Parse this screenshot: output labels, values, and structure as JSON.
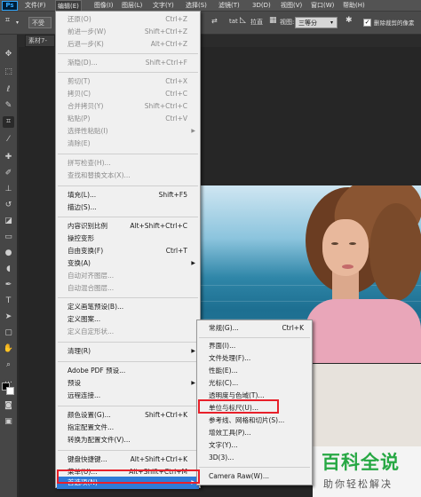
{
  "app": {
    "logo": "Ps"
  },
  "menubar": {
    "items": [
      "文件(F)",
      "编辑(E)",
      "图像(I)",
      "图层(L)",
      "文字(Y)",
      "选择(S)",
      "滤镜(T)",
      "3D(D)",
      "视图(V)",
      "窗口(W)",
      "帮助(H)"
    ]
  },
  "optionbar": {
    "ratio_label": "不受",
    "straighten": "拉直",
    "view_label": "视图:",
    "view_value": "三等分",
    "delete_cropped_label": "删除裁剪的像素"
  },
  "document": {
    "tab_title": "素材7-"
  },
  "edit_menu": {
    "items": [
      {
        "label": "还原(O)",
        "shortcut": "Ctrl+Z",
        "disabled": true
      },
      {
        "label": "前进一步(W)",
        "shortcut": "Shift+Ctrl+Z",
        "disabled": true
      },
      {
        "label": "后退一步(K)",
        "shortcut": "Alt+Ctrl+Z",
        "disabled": true
      },
      {
        "label": "渐隐(D)...",
        "shortcut": "Shift+Ctrl+F",
        "disabled": true
      },
      {
        "label": "剪切(T)",
        "shortcut": "Ctrl+X",
        "disabled": true
      },
      {
        "label": "拷贝(C)",
        "shortcut": "Ctrl+C",
        "disabled": true
      },
      {
        "label": "合并拷贝(Y)",
        "shortcut": "Shift+Ctrl+C",
        "disabled": true
      },
      {
        "label": "粘贴(P)",
        "shortcut": "Ctrl+V",
        "disabled": true
      },
      {
        "label": "选择性粘贴(I)",
        "shortcut": "",
        "disabled": true,
        "submenu": true
      },
      {
        "label": "清除(E)",
        "shortcut": "",
        "disabled": true
      },
      {
        "label": "拼写检查(H)...",
        "shortcut": "",
        "disabled": true
      },
      {
        "label": "查找和替换文本(X)...",
        "shortcut": "",
        "disabled": true
      },
      {
        "label": "填充(L)...",
        "shortcut": "Shift+F5",
        "disabled": false
      },
      {
        "label": "描边(S)...",
        "shortcut": "",
        "disabled": false
      },
      {
        "label": "内容识别比例",
        "shortcut": "Alt+Shift+Ctrl+C",
        "disabled": false
      },
      {
        "label": "操控变形",
        "shortcut": "",
        "disabled": false
      },
      {
        "label": "自由变换(F)",
        "shortcut": "Ctrl+T",
        "disabled": false
      },
      {
        "label": "变换(A)",
        "shortcut": "",
        "disabled": false,
        "submenu": true
      },
      {
        "label": "自动对齐图层...",
        "shortcut": "",
        "disabled": true
      },
      {
        "label": "自动混合图层...",
        "shortcut": "",
        "disabled": true
      },
      {
        "label": "定义画笔预设(B)...",
        "shortcut": "",
        "disabled": false
      },
      {
        "label": "定义图案...",
        "shortcut": "",
        "disabled": false
      },
      {
        "label": "定义自定形状...",
        "shortcut": "",
        "disabled": true
      },
      {
        "label": "清理(R)",
        "shortcut": "",
        "disabled": false,
        "submenu": true
      },
      {
        "label": "Adobe PDF 预设...",
        "shortcut": "",
        "disabled": false
      },
      {
        "label": "预设",
        "shortcut": "",
        "disabled": false,
        "submenu": true
      },
      {
        "label": "远程连接...",
        "shortcut": "",
        "disabled": false
      },
      {
        "label": "颜色设置(G)...",
        "shortcut": "Shift+Ctrl+K",
        "disabled": false
      },
      {
        "label": "指定配置文件...",
        "shortcut": "",
        "disabled": false
      },
      {
        "label": "转换为配置文件(V)...",
        "shortcut": "",
        "disabled": false
      },
      {
        "label": "键盘快捷键...",
        "shortcut": "Alt+Shift+Ctrl+K",
        "disabled": false
      },
      {
        "label": "菜单(U)...",
        "shortcut": "Alt+Shift+Ctrl+M",
        "disabled": false
      },
      {
        "label": "首选项(N)",
        "shortcut": "",
        "disabled": false,
        "submenu": true
      }
    ]
  },
  "preferences_submenu": {
    "items": [
      {
        "label": "常规(G)...",
        "shortcut": "Ctrl+K"
      },
      {
        "label": "界面(I)...",
        "shortcut": ""
      },
      {
        "label": "文件处理(F)...",
        "shortcut": ""
      },
      {
        "label": "性能(E)...",
        "shortcut": ""
      },
      {
        "label": "光标(C)...",
        "shortcut": ""
      },
      {
        "label": "透明度与色域(T)...",
        "shortcut": ""
      },
      {
        "label": "单位与标尺(U)...",
        "shortcut": ""
      },
      {
        "label": "参考线、网格和切片(S)...",
        "shortcut": ""
      },
      {
        "label": "增效工具(P)...",
        "shortcut": ""
      },
      {
        "label": "文字(Y)...",
        "shortcut": ""
      },
      {
        "label": "3D(3)...",
        "shortcut": ""
      },
      {
        "label": "Camera Raw(W)...",
        "shortcut": ""
      }
    ]
  },
  "watermark": {
    "main": "百科全说",
    "sub": "助你轻松解决"
  },
  "colors": {
    "highlight": "#2f7bd8",
    "annotation_red": "#e8202a",
    "watermark_green": "#27a844"
  }
}
